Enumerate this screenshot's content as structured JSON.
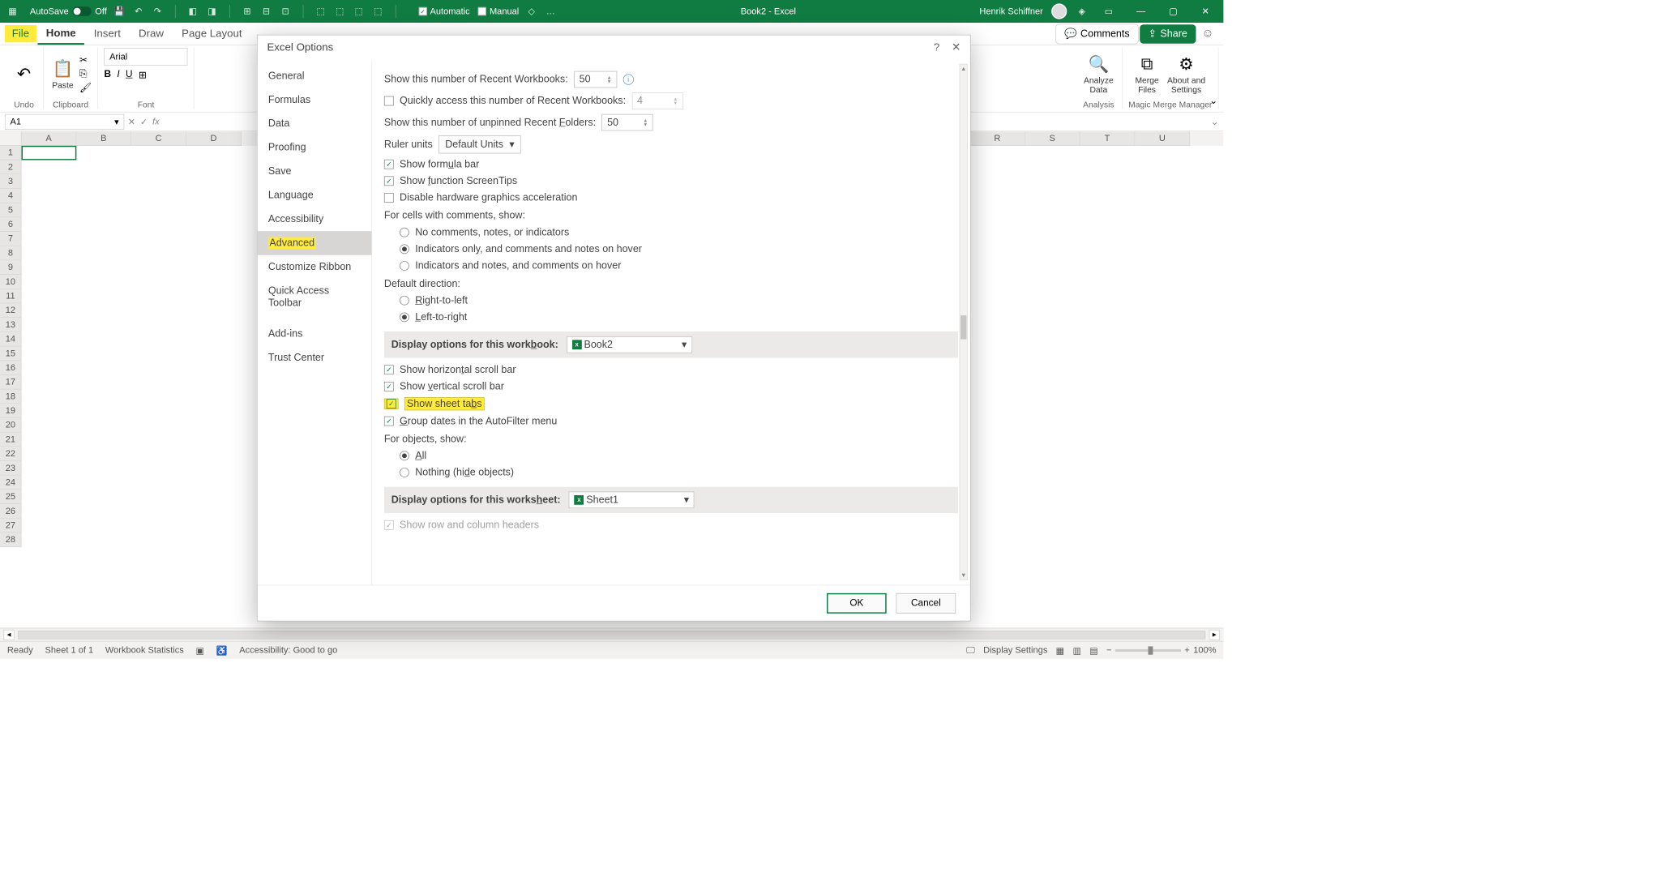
{
  "titlebar": {
    "autosave_label": "AutoSave",
    "autosave_state": "Off",
    "automatic_label": "Automatic",
    "manual_label": "Manual",
    "doc_title": "Book2 - Excel",
    "user_name": "Henrik Schiffner"
  },
  "ribbon_tabs": {
    "file": "File",
    "home": "Home",
    "insert": "Insert",
    "draw": "Draw",
    "page_layout": "Page Layout",
    "comments": "Comments",
    "share": "Share"
  },
  "ribbon": {
    "undo_group": "Undo",
    "clipboard_group": "Clipboard",
    "paste": "Paste",
    "font_group": "Font",
    "font_name": "Arial",
    "analysis_group": "Analysis",
    "analyze_data": "Analyze\nData",
    "merge_files": "Merge\nFiles",
    "about_settings": "About and\nSettings",
    "magic_merge_group": "Magic Merge Manager"
  },
  "namebox": "A1",
  "columns": [
    "A",
    "B",
    "C",
    "D",
    "R",
    "S",
    "T",
    "U"
  ],
  "rows": [
    1,
    2,
    3,
    4,
    5,
    6,
    7,
    8,
    9,
    10,
    11,
    12,
    13,
    14,
    15,
    16,
    17,
    18,
    19,
    20,
    21,
    22,
    23,
    24,
    25,
    26,
    27,
    28
  ],
  "statusbar": {
    "ready": "Ready",
    "sheet": "Sheet 1 of 1",
    "stats": "Workbook Statistics",
    "accessibility": "Accessibility: Good to go",
    "display_settings": "Display Settings",
    "zoom": "100%"
  },
  "dialog": {
    "title": "Excel Options",
    "nav": {
      "general": "General",
      "formulas": "Formulas",
      "data": "Data",
      "proofing": "Proofing",
      "save": "Save",
      "language": "Language",
      "accessibility": "Accessibility",
      "advanced": "Advanced",
      "customize_ribbon": "Customize Ribbon",
      "qat": "Quick Access Toolbar",
      "addins": "Add-ins",
      "trust": "Trust Center"
    },
    "opts": {
      "recent_workbooks_label": "Show this number of Recent Workbooks:",
      "recent_workbooks_value": "50",
      "quick_access_recent": "Quickly access this number of Recent Workbooks:",
      "quick_access_value": "4",
      "unpinned_folders_label": "Show this number of unpinned Recent Folders:",
      "unpinned_folders_value": "50",
      "ruler_units_label": "Ruler units",
      "ruler_units_value": "Default Units",
      "show_formula_bar": "Show formula bar",
      "show_screentips": "Show function ScreenTips",
      "disable_hw": "Disable hardware graphics acceleration",
      "comments_label": "For cells with comments, show:",
      "comments_none": "No comments, notes, or indicators",
      "comments_ind_hover": "Indicators only, and comments and notes on hover",
      "comments_ind_always": "Indicators and notes, and comments on hover",
      "default_direction": "Default direction:",
      "rtl": "Right-to-left",
      "ltr": "Left-to-right",
      "section_workbook": "Display options for this workbook:",
      "workbook_name": "Book2",
      "h_scroll": "Show horizontal scroll bar",
      "v_scroll": "Show vertical scroll bar",
      "sheet_tabs": "Show sheet tabs",
      "group_dates": "Group dates in the AutoFilter menu",
      "objects_label": "For objects, show:",
      "obj_all": "All",
      "obj_nothing": "Nothing (hide objects)",
      "section_worksheet": "Display options for this worksheet:",
      "worksheet_name": "Sheet1",
      "row_col_headers": "Show row and column headers"
    },
    "footer": {
      "ok": "OK",
      "cancel": "Cancel"
    }
  }
}
